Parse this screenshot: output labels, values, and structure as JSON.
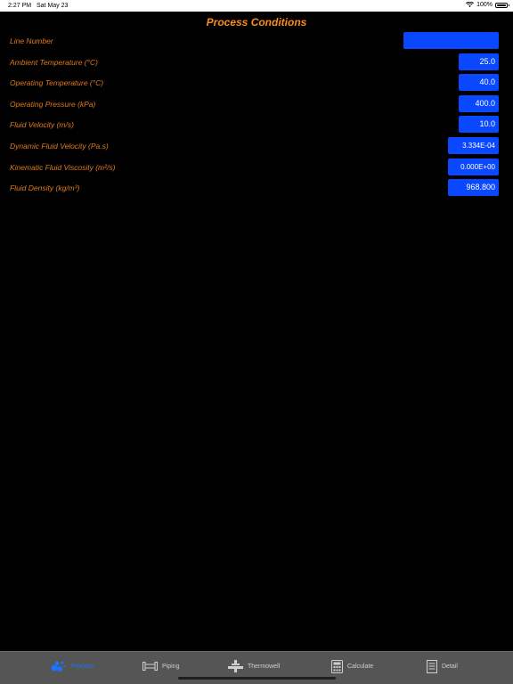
{
  "status_bar": {
    "time": "2:27 PM",
    "date": "Sat May 23",
    "battery": "100%"
  },
  "title": "Process Conditions",
  "rows": [
    {
      "label": "Line Number",
      "value": ""
    },
    {
      "label": "Ambient Temperature (°C)",
      "value": "25.0"
    },
    {
      "label": "Operating Temperature (°C)",
      "value": "40.0"
    },
    {
      "label": "Operating Pressure (kPa)",
      "value": "400.0"
    },
    {
      "label": "Fluid Velocity (m/s)",
      "value": "10.0"
    },
    {
      "label": "Dynamic Fluid Velocity (Pa.s)",
      "value": "3.334E-04"
    },
    {
      "label": "Kinematic Fluid Viscosity (m²/s)",
      "value": "0.000E+00"
    },
    {
      "label": "Fluid Density (kg/m³)",
      "value": "968.800"
    }
  ],
  "tabs": [
    {
      "label": "Process",
      "icon": "process-icon",
      "active": true
    },
    {
      "label": "Piping",
      "icon": "piping-icon",
      "active": false
    },
    {
      "label": "Thermowell",
      "icon": "thermowell-icon",
      "active": false
    },
    {
      "label": "Calculate",
      "icon": "calculator-icon",
      "active": false
    },
    {
      "label": "Detail",
      "icon": "detail-icon",
      "active": false
    }
  ],
  "colors": {
    "accent": "#ff8c1a",
    "label": "#e07a1c",
    "field": "#0a48ff",
    "tab_active": "#1a74ff",
    "tabbar": "#555555"
  }
}
